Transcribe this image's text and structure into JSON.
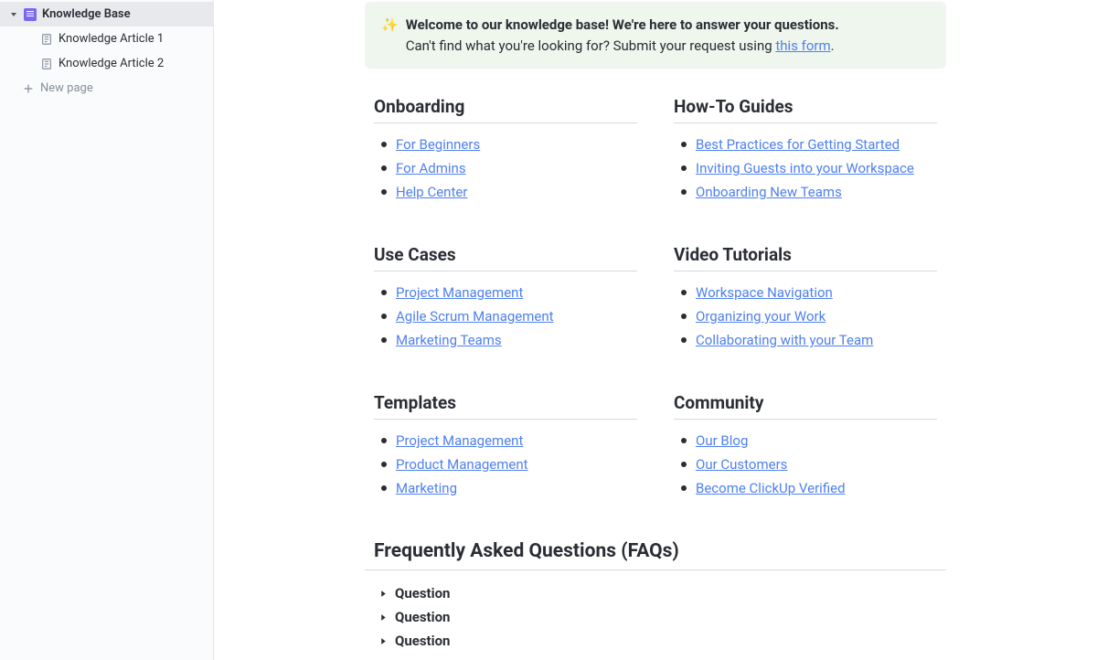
{
  "sidebar": {
    "root": "Knowledge Base",
    "children": [
      "Knowledge Article 1",
      "Knowledge Article 2"
    ],
    "newPage": "New page"
  },
  "banner": {
    "emoji": "✨",
    "line1": "Welcome to our knowledge base! We're here to answer your questions.",
    "line2a": "Can't find what you're looking for? Submit your request using ",
    "line2link": "this form",
    "line2b": "."
  },
  "sections": [
    {
      "title": "Onboarding",
      "links": [
        "For Beginners",
        "For Admins",
        "Help Center"
      ]
    },
    {
      "title": "How-To Guides",
      "links": [
        "Best Practices for Getting Started",
        "Inviting Guests into your Workspace",
        "Onboarding New Teams"
      ]
    },
    {
      "title": "Use Cases",
      "links": [
        "Project Management",
        "Agile Scrum Management",
        "Marketing Teams"
      ]
    },
    {
      "title": "Video Tutorials",
      "links": [
        "Workspace Navigation",
        "Organizing your Work",
        "Collaborating with your Team"
      ]
    },
    {
      "title": "Templates",
      "links": [
        "Project Management",
        "Product Management",
        "Marketing"
      ]
    },
    {
      "title": "Community",
      "links": [
        "Our Blog",
        "Our Customers",
        "Become ClickUp Verified"
      ]
    }
  ],
  "faq": {
    "title": "Frequently Asked Questions (FAQs)",
    "items": [
      "Question",
      "Question",
      "Question"
    ]
  }
}
